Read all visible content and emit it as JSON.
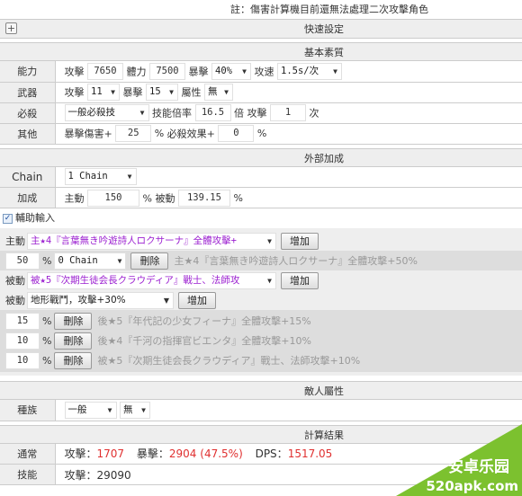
{
  "note": "註：傷害計算機目前還無法處理二次攻擊角色",
  "quick_settings": {
    "title": "快速設定",
    "expand_icon": "plus-icon"
  },
  "basic": {
    "title": "基本素質",
    "rows": {
      "ability": {
        "label": "能力",
        "atk_label": "攻擊",
        "atk": "7650",
        "hp_label": "體力",
        "hp": "7500",
        "crit_label": "暴擊",
        "crit": "40%",
        "spd_label": "攻速",
        "spd": "1.5s/次"
      },
      "weapon": {
        "label": "武器",
        "atk_label": "攻擊",
        "atk": "11",
        "crit_label": "暴擊",
        "crit": "15",
        "attr_label": "屬性",
        "attr": "無"
      },
      "skill": {
        "label": "必殺",
        "type": "一般必殺技",
        "mult_label": "技能倍率",
        "mult": "16.5",
        "times_label": "倍 攻擊",
        "hits": "1",
        "hits_unit": "次"
      },
      "other": {
        "label": "其他",
        "critdmg_label": "暴擊傷害+",
        "critdmg": "25",
        "pct1": "%",
        "skilleff_label": "必殺效果+",
        "skilleff": "0",
        "pct2": "%"
      }
    }
  },
  "external": {
    "title": "外部加成",
    "chain": {
      "label": "Chain",
      "value": "1 Chain"
    },
    "bonus": {
      "label": "加成",
      "active_label": "主動",
      "active": "150",
      "pct1": "% 被動",
      "passive": "139.15",
      "pct2": "%"
    }
  },
  "aux": {
    "checkbox_label": "輔助輸入",
    "checked": true,
    "active_label": "主動",
    "active_select": "主★4『言葉無き吟遊詩人ロクサーナ』全體攻擊+",
    "add_label": "增加",
    "active_items": [
      {
        "value": "50",
        "pct": "%",
        "chain": "0 Chain",
        "remove": "刪除",
        "desc": "主★4『言葉無き吟遊詩人ロクサーナ』全體攻擊+50%"
      }
    ],
    "passive_label": "被動",
    "passive_select": "被★5『次期生徒会長クラウディア』戰士、法師攻",
    "terrain_label": "被動",
    "terrain_select": "地形戰鬥，攻擊+30%",
    "passive_items": [
      {
        "value": "15",
        "pct": "%",
        "remove": "刪除",
        "desc": "後★5『年代記の少女フィーナ』全體攻擊+15%"
      },
      {
        "value": "10",
        "pct": "%",
        "remove": "刪除",
        "desc": "後★4『千河の指揮官ビエンタ』全體攻擊+10%"
      },
      {
        "value": "10",
        "pct": "%",
        "remove": "刪除",
        "desc": "被★5『次期生徒会長クラウディア』戰士、法師攻擊+10%"
      }
    ]
  },
  "enemy": {
    "title": "敵人屬性",
    "race": {
      "label": "種族",
      "value1": "一般",
      "value2": "無"
    }
  },
  "result": {
    "title": "計算結果",
    "normal": {
      "label": "通常",
      "atk_label": "攻擊：",
      "atk": "1707",
      "crit_label": "暴擊：",
      "crit": "2904 (47.5%)",
      "dps_label": "DPS：",
      "dps": "1517.05"
    },
    "skill": {
      "label": "技能",
      "atk_label": "攻擊：",
      "atk": "29090"
    }
  },
  "watermark": {
    "line1": "安卓乐园",
    "line2": "520apk.com",
    "color": "#7cc12f"
  }
}
